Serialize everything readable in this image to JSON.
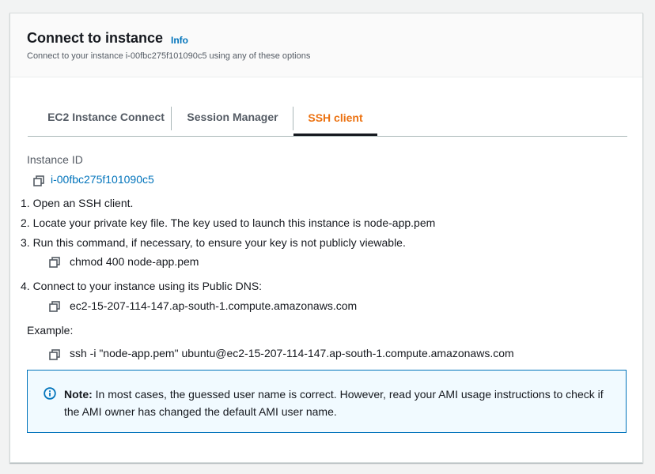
{
  "panel": {
    "title": "Connect to instance",
    "info_link": "Info",
    "description": "Connect to your instance i-00fbc275f101090c5 using any of these options"
  },
  "tabs": [
    {
      "label": "EC2 Instance Connect"
    },
    {
      "label": "Session Manager"
    },
    {
      "label": "SSH client",
      "active": true
    }
  ],
  "ssh": {
    "instance_id_label": "Instance ID",
    "instance_id": "i-00fbc275f101090c5",
    "steps": [
      "1. Open an SSH client.",
      "2. Locate your private key file. The key used to launch this instance is node-app.pem",
      "3. Run this command, if necessary, to ensure your key is not publicly viewable.",
      "4. Connect to your instance using its Public DNS:"
    ],
    "chmod_command": "chmod 400 node-app.pem",
    "public_dns": "ec2-15-207-114-147.ap-south-1.compute.amazonaws.com",
    "example_label": "Example:",
    "example_command": "ssh -i \"node-app.pem\" ubuntu@ec2-15-207-114-147.ap-south-1.compute.amazonaws.com"
  },
  "note": {
    "prefix": "Note:",
    "text": " In most cases, the guessed user name is correct. However, read your AMI usage instructions to check if the AMI owner has changed the default AMI user name."
  },
  "colors": {
    "accent": "#ec7211",
    "link": "#0073bb",
    "info_bg": "#f1faff"
  }
}
